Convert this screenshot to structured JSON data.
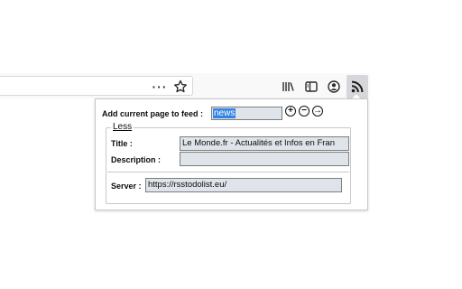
{
  "toolbar": {
    "overflow_icon": "more-dots-icon",
    "bookmark_icon": "star-icon",
    "library_icon": "library-icon",
    "sidebar_icon": "sidebar-icon",
    "account_icon": "account-icon",
    "rss_icon": "rss-icon"
  },
  "popup": {
    "add_label": "Add current page to feed :",
    "feed_name": "news",
    "buttons": {
      "add": "+",
      "remove": "−",
      "go": "→"
    },
    "legend": "Less",
    "title_label": "Title :",
    "title_value": "Le Monde.fr - Actualités et Infos en Fran",
    "description_label": "Description :",
    "description_value": "",
    "server_label": "Server :",
    "server_value": "https://rsstodolist.eu/"
  },
  "colors": {
    "selection": "#3584e4",
    "field_bg": "#dfe4ea",
    "active_button_bg": "#d7d7db"
  }
}
